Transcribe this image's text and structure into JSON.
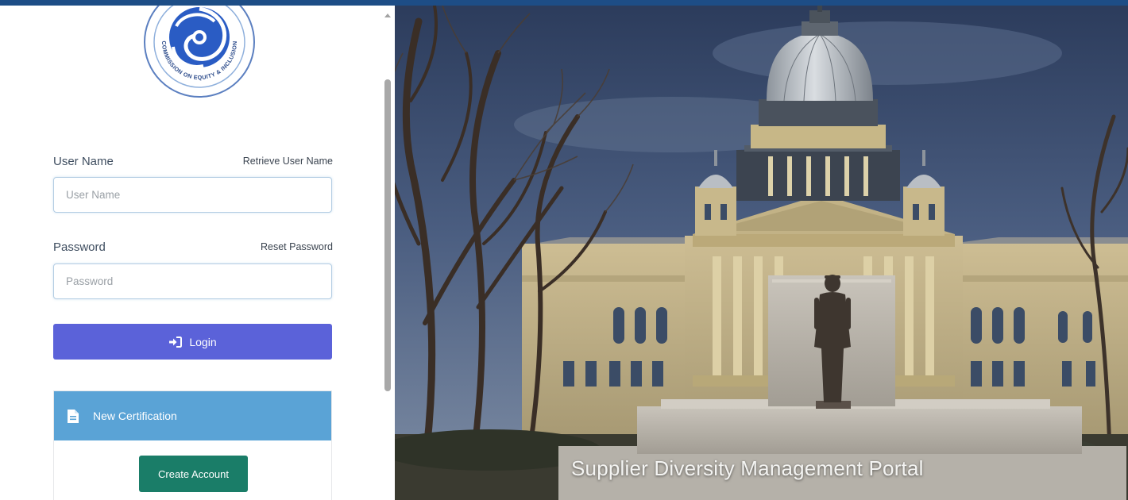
{
  "logo": {
    "text": "COMMISSION ON EQUITY & INCLUSION"
  },
  "login_form": {
    "username_label": "User Name",
    "retrieve_username_link": "Retrieve User Name",
    "username_placeholder": "User Name",
    "password_label": "Password",
    "reset_password_link": "Reset Password",
    "password_placeholder": "Password",
    "login_button_label": "Login",
    "login_icon": "sign-in-icon"
  },
  "new_certification": {
    "header_label": "New Certification",
    "header_icon": "document-icon",
    "create_account_label": "Create Account"
  },
  "hero": {
    "caption": "Supplier Diversity Management Portal"
  },
  "colors": {
    "top_strip": "#1d4d86",
    "login_button": "#5b62d9",
    "certification_header": "#5aa3d6",
    "create_account_button": "#1a7d68"
  }
}
